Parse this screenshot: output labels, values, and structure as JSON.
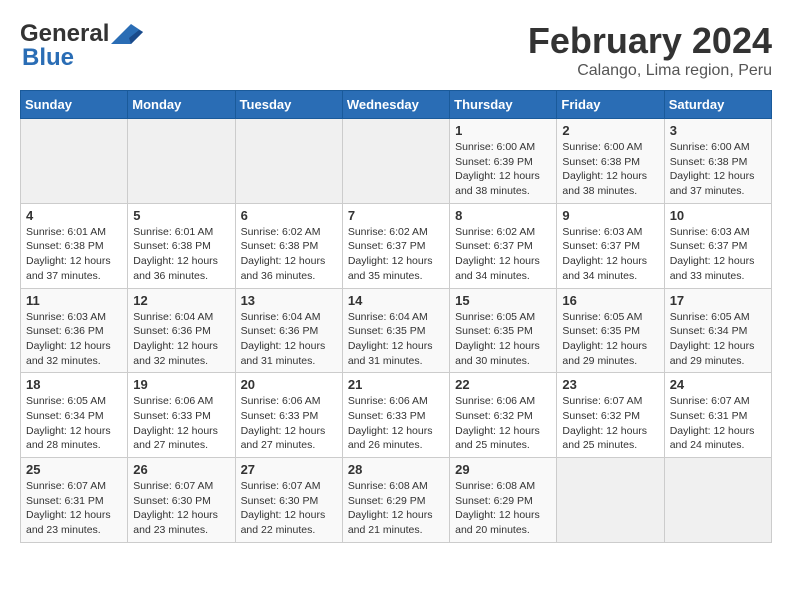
{
  "logo": {
    "line1": "General",
    "line2": "Blue"
  },
  "title": "February 2024",
  "subtitle": "Calango, Lima region, Peru",
  "days_of_week": [
    "Sunday",
    "Monday",
    "Tuesday",
    "Wednesday",
    "Thursday",
    "Friday",
    "Saturday"
  ],
  "weeks": [
    [
      {
        "day": "",
        "info": ""
      },
      {
        "day": "",
        "info": ""
      },
      {
        "day": "",
        "info": ""
      },
      {
        "day": "",
        "info": ""
      },
      {
        "day": "1",
        "info": "Sunrise: 6:00 AM\nSunset: 6:39 PM\nDaylight: 12 hours\nand 38 minutes."
      },
      {
        "day": "2",
        "info": "Sunrise: 6:00 AM\nSunset: 6:38 PM\nDaylight: 12 hours\nand 38 minutes."
      },
      {
        "day": "3",
        "info": "Sunrise: 6:00 AM\nSunset: 6:38 PM\nDaylight: 12 hours\nand 37 minutes."
      }
    ],
    [
      {
        "day": "4",
        "info": "Sunrise: 6:01 AM\nSunset: 6:38 PM\nDaylight: 12 hours\nand 37 minutes."
      },
      {
        "day": "5",
        "info": "Sunrise: 6:01 AM\nSunset: 6:38 PM\nDaylight: 12 hours\nand 36 minutes."
      },
      {
        "day": "6",
        "info": "Sunrise: 6:02 AM\nSunset: 6:38 PM\nDaylight: 12 hours\nand 36 minutes."
      },
      {
        "day": "7",
        "info": "Sunrise: 6:02 AM\nSunset: 6:37 PM\nDaylight: 12 hours\nand 35 minutes."
      },
      {
        "day": "8",
        "info": "Sunrise: 6:02 AM\nSunset: 6:37 PM\nDaylight: 12 hours\nand 34 minutes."
      },
      {
        "day": "9",
        "info": "Sunrise: 6:03 AM\nSunset: 6:37 PM\nDaylight: 12 hours\nand 34 minutes."
      },
      {
        "day": "10",
        "info": "Sunrise: 6:03 AM\nSunset: 6:37 PM\nDaylight: 12 hours\nand 33 minutes."
      }
    ],
    [
      {
        "day": "11",
        "info": "Sunrise: 6:03 AM\nSunset: 6:36 PM\nDaylight: 12 hours\nand 32 minutes."
      },
      {
        "day": "12",
        "info": "Sunrise: 6:04 AM\nSunset: 6:36 PM\nDaylight: 12 hours\nand 32 minutes."
      },
      {
        "day": "13",
        "info": "Sunrise: 6:04 AM\nSunset: 6:36 PM\nDaylight: 12 hours\nand 31 minutes."
      },
      {
        "day": "14",
        "info": "Sunrise: 6:04 AM\nSunset: 6:35 PM\nDaylight: 12 hours\nand 31 minutes."
      },
      {
        "day": "15",
        "info": "Sunrise: 6:05 AM\nSunset: 6:35 PM\nDaylight: 12 hours\nand 30 minutes."
      },
      {
        "day": "16",
        "info": "Sunrise: 6:05 AM\nSunset: 6:35 PM\nDaylight: 12 hours\nand 29 minutes."
      },
      {
        "day": "17",
        "info": "Sunrise: 6:05 AM\nSunset: 6:34 PM\nDaylight: 12 hours\nand 29 minutes."
      }
    ],
    [
      {
        "day": "18",
        "info": "Sunrise: 6:05 AM\nSunset: 6:34 PM\nDaylight: 12 hours\nand 28 minutes."
      },
      {
        "day": "19",
        "info": "Sunrise: 6:06 AM\nSunset: 6:33 PM\nDaylight: 12 hours\nand 27 minutes."
      },
      {
        "day": "20",
        "info": "Sunrise: 6:06 AM\nSunset: 6:33 PM\nDaylight: 12 hours\nand 27 minutes."
      },
      {
        "day": "21",
        "info": "Sunrise: 6:06 AM\nSunset: 6:33 PM\nDaylight: 12 hours\nand 26 minutes."
      },
      {
        "day": "22",
        "info": "Sunrise: 6:06 AM\nSunset: 6:32 PM\nDaylight: 12 hours\nand 25 minutes."
      },
      {
        "day": "23",
        "info": "Sunrise: 6:07 AM\nSunset: 6:32 PM\nDaylight: 12 hours\nand 25 minutes."
      },
      {
        "day": "24",
        "info": "Sunrise: 6:07 AM\nSunset: 6:31 PM\nDaylight: 12 hours\nand 24 minutes."
      }
    ],
    [
      {
        "day": "25",
        "info": "Sunrise: 6:07 AM\nSunset: 6:31 PM\nDaylight: 12 hours\nand 23 minutes."
      },
      {
        "day": "26",
        "info": "Sunrise: 6:07 AM\nSunset: 6:30 PM\nDaylight: 12 hours\nand 23 minutes."
      },
      {
        "day": "27",
        "info": "Sunrise: 6:07 AM\nSunset: 6:30 PM\nDaylight: 12 hours\nand 22 minutes."
      },
      {
        "day": "28",
        "info": "Sunrise: 6:08 AM\nSunset: 6:29 PM\nDaylight: 12 hours\nand 21 minutes."
      },
      {
        "day": "29",
        "info": "Sunrise: 6:08 AM\nSunset: 6:29 PM\nDaylight: 12 hours\nand 20 minutes."
      },
      {
        "day": "",
        "info": ""
      },
      {
        "day": "",
        "info": ""
      }
    ]
  ]
}
